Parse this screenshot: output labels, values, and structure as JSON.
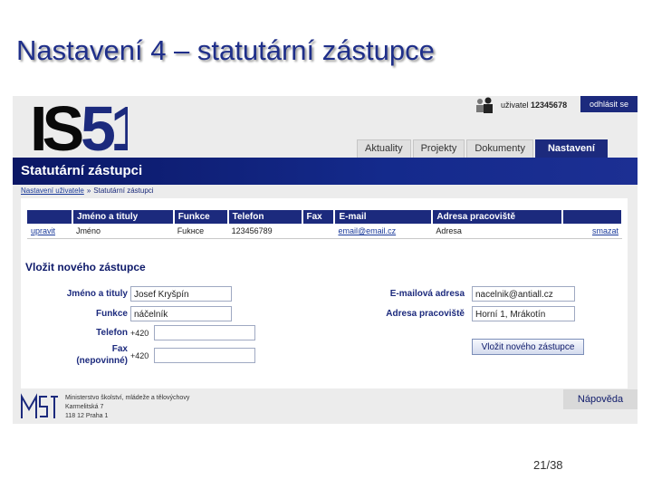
{
  "slide": {
    "title": "Nastavení 4 – statutární zástupce",
    "page_number": "21/38"
  },
  "app": {
    "logo_text": "IS51",
    "user_label": "uživatel",
    "user_id": "12345678",
    "logout_label": "odhlásit se",
    "tabs": [
      {
        "label": "Aktuality",
        "active": false
      },
      {
        "label": "Projekty",
        "active": false
      },
      {
        "label": "Dokumenty",
        "active": false
      },
      {
        "label": "Nastavení",
        "active": true
      }
    ],
    "page_heading": "Statutární zástupci",
    "breadcrumb": {
      "parent": "Nastavení uživatele",
      "separator": "»",
      "current": "Statutární zástupci"
    }
  },
  "table": {
    "headers": [
      "",
      "Jméno a tituly",
      "Funkce",
      "Telefon",
      "Fax",
      "E-mail",
      "Adresa pracoviště",
      ""
    ],
    "row": {
      "edit": "upravit",
      "name": "Jméno",
      "function": "Fukнce",
      "phone": "123456789",
      "fax": "",
      "email": "email@email.cz",
      "address": "Adresa",
      "delete": "smazat"
    }
  },
  "form": {
    "heading": "Vložit nového zástupce",
    "name_label": "Jméno a tituly",
    "name_value": "Josef Kryšpín",
    "function_label": "Funkce",
    "function_value": "náčelník",
    "phone_label": "Telefon",
    "phone_prefix": "+420",
    "phone_value": "",
    "fax_label": "Fax",
    "fax_optional": "(nepovinné)",
    "fax_prefix": "+420",
    "fax_value": "",
    "email_label": "E-mailová adresa",
    "email_value": "nacelnik@antiall.cz",
    "address_label": "Adresa pracoviště",
    "address_value": "Horní 1, Mrákotín",
    "submit_label": "Vložit nového zástupce"
  },
  "footer": {
    "ministry_lines": [
      "Ministerstvo školství, mládeže a tělovýchovy",
      "Karmelitská 7",
      "118 12 Praha 1"
    ],
    "help_label": "Nápověda"
  },
  "colors": {
    "navy": "#1c2a7d",
    "title_blue": "#1f2f8a",
    "background": "#ececec"
  }
}
